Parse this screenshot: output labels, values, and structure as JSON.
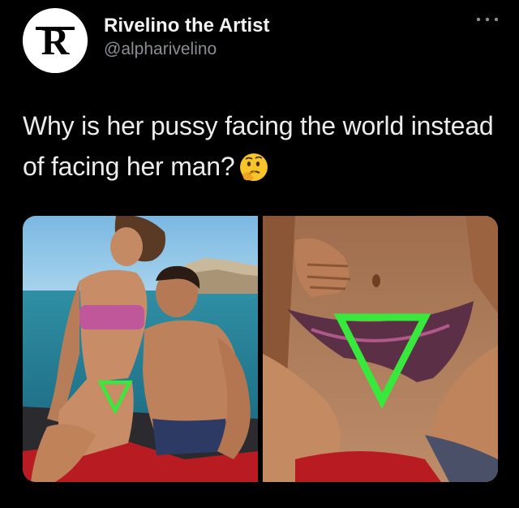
{
  "author": {
    "display_name": "Rivelino the Artist",
    "handle": "@alpharivelino",
    "avatar_letter": "R",
    "avatar_icon": "r-logo-icon"
  },
  "menu": {
    "icon": "more-options-icon"
  },
  "tweet": {
    "text": "Why is her pussy facing the world instead of facing her man?",
    "emoji": "thinking-face-emoji"
  },
  "media": {
    "count": 2
  },
  "colors": {
    "background": "#000000",
    "text_primary": "#e7e9ea",
    "text_secondary": "#8b8f94",
    "triangle_marker": "#39e83c"
  }
}
